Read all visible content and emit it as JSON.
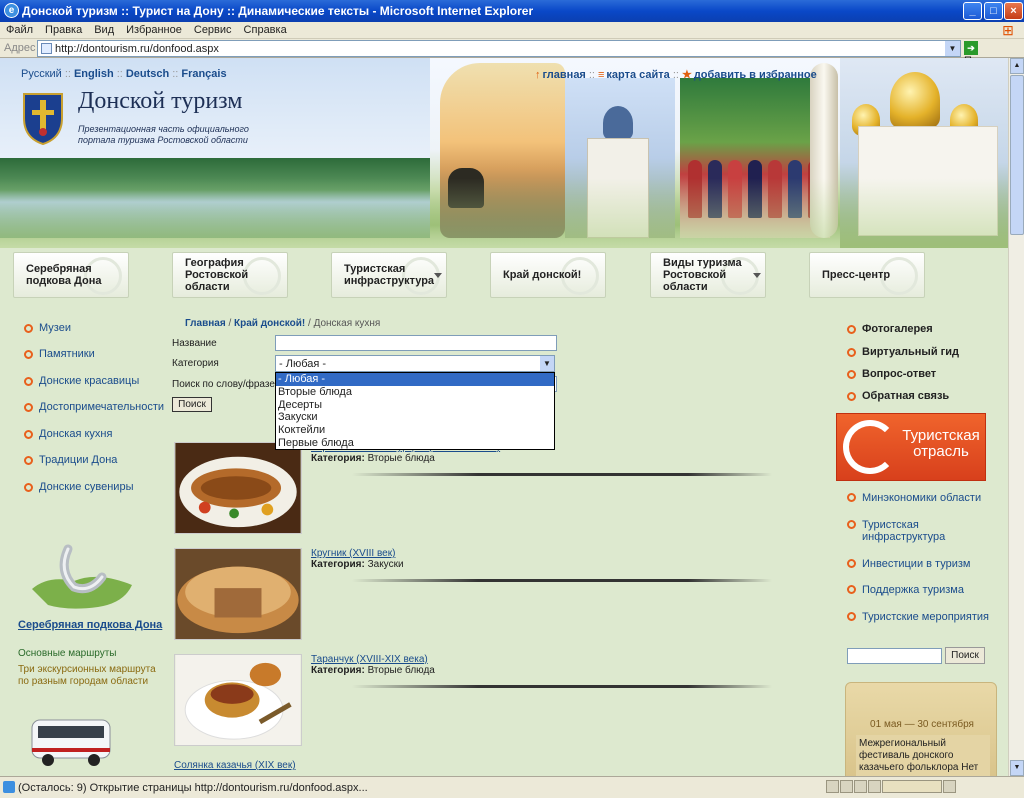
{
  "window": {
    "title": "Донской туризм :: Турист на Дону :: Динамические тексты - Microsoft Internet Explorer",
    "min_icon": "minimize-icon",
    "max_icon": "maximize-icon",
    "close_icon": "close-icon"
  },
  "menubar": [
    "Файл",
    "Правка",
    "Вид",
    "Избранное",
    "Сервис",
    "Справка"
  ],
  "address": {
    "label": "Адрес",
    "url": "http://dontourism.ru/donfood.aspx",
    "go_label": "Переход"
  },
  "status": {
    "text": "(Осталось: 9) Открытие страницы http://dontourism.ru/donfood.aspx..."
  },
  "header": {
    "languages": [
      "Русский",
      "English",
      "Deutsch",
      "Français"
    ],
    "lang_sep": "::",
    "top_links": [
      "главная",
      "карта сайта",
      "добавить в избранное"
    ],
    "site_name": "Донской туризм",
    "tagline": "Презентационная часть официального портала туризма Ростовской области"
  },
  "nav": [
    {
      "label": "Серебряная подкова Дона",
      "dropdown": false
    },
    {
      "label": "География Ростовской области",
      "dropdown": false
    },
    {
      "label": "Туристская инфраструктура",
      "dropdown": true
    },
    {
      "label": "Край донской!",
      "dropdown": false
    },
    {
      "label": "Виды туризма Ростовской области",
      "dropdown": true
    },
    {
      "label": "Пресс-центр",
      "dropdown": false
    }
  ],
  "left_menu": [
    "Музеи",
    "Памятники",
    "Донские красавицы",
    "Достопримечательности",
    "Донская кухня",
    "Традиции Дона",
    "Донские сувениры"
  ],
  "left_promo": {
    "title": "Серебряная подкова Дона",
    "sub": "Основные маршруты",
    "desc": "Три экскурсионных маршрута по разным городам области"
  },
  "breadcrumb": {
    "items": [
      "Главная",
      "Край донской!"
    ],
    "current": "Донская кухня",
    "sep": "/"
  },
  "form": {
    "name_label": "Название",
    "category_label": "Категория",
    "word_label": "Поиск по слову/фразе",
    "category_value": "- Любая -",
    "category_options": [
      "- Любая -",
      "Вторые блюда",
      "Десерты",
      "Закуски",
      "Коктейли",
      "Первые блюда"
    ],
    "search_label": "Поиск"
  },
  "items": [
    {
      "title": "Карп с соленым огурцом (XVIII-XIX века)",
      "cat_label": "Категория:",
      "category": "Вторые блюда"
    },
    {
      "title": "Кругник (XVIII век)",
      "cat_label": "Категория:",
      "category": "Закуски"
    },
    {
      "title": "Таранчук (XVIII-XIX века)",
      "cat_label": "Категория:",
      "category": "Вторые блюда"
    },
    {
      "title": "Солянка казачья (XIX век)",
      "cat_label": "",
      "category": ""
    }
  ],
  "right_menu": [
    "Фотогалерея",
    "Виртуальный гид",
    "Вопрос-ответ",
    "Обратная связь"
  ],
  "tour_banner": "Туристская отрасль",
  "right_links": [
    "Минэкономики области",
    "Туристская инфраструктура",
    "Инвестиции в туризм",
    "Поддержка туризма",
    "Туристские мероприятия"
  ],
  "right_search": {
    "button": "Поиск"
  },
  "event": {
    "date": "01 мая — 30 сентября",
    "text": "Межрегиональный фестиваль донского казачьего фольклора Нет"
  },
  "colors": {
    "accent": "#e8601c",
    "link": "#1a4c8c",
    "page_bg": "#dde9cf",
    "ie_blue": "#0a48c8"
  }
}
